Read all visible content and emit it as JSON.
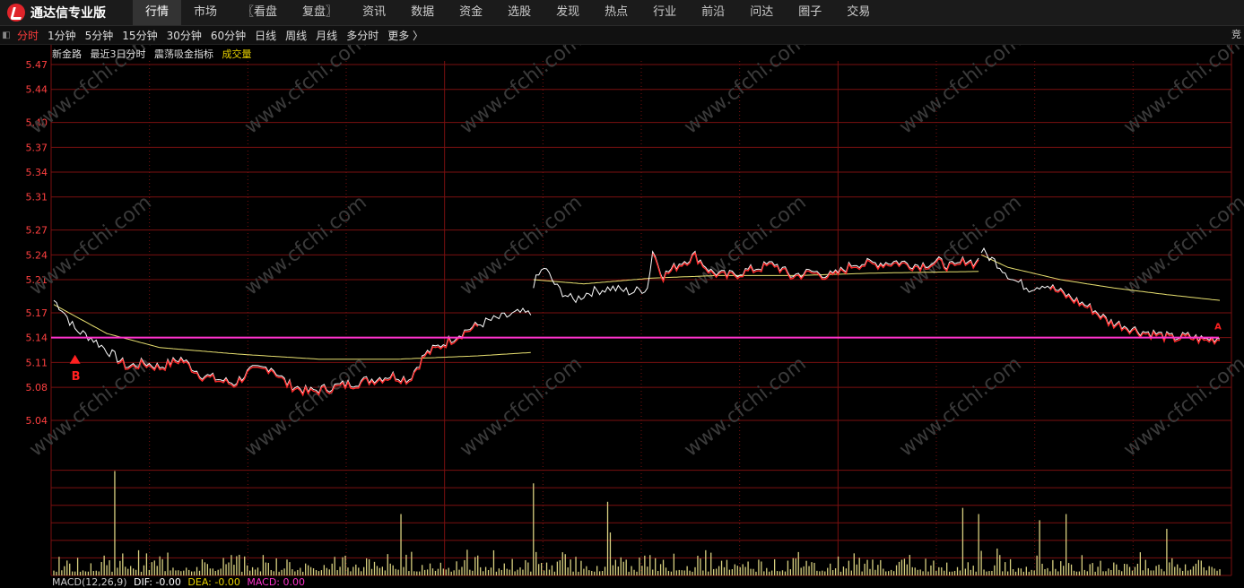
{
  "app": {
    "title": "通达信专业版"
  },
  "menu": [
    "行情",
    "市场",
    "〖看盘",
    "复盘〗",
    "资讯",
    "数据",
    "资金",
    "选股",
    "发现",
    "热点",
    "行业",
    "前沿",
    "问达",
    "圈子",
    "交易"
  ],
  "menu_active": "行情",
  "periods": [
    "分时",
    "1分钟",
    "5分钟",
    "15分钟",
    "30分钟",
    "60分钟",
    "日线",
    "周线",
    "月线",
    "多分时",
    "更多 〉"
  ],
  "period_active": "分时",
  "right_edge_text": "竞",
  "stock": {
    "name": "新金路",
    "mode": "最近3日分时",
    "indicator": "震荡吸金指标",
    "volume_label": "成交量"
  },
  "macd": {
    "title": "MACD(12,26,9)",
    "dif": "DIF: -0.00",
    "dea": "DEA: -0.00",
    "macd": "MACD: 0.00"
  },
  "watermark": "www.cfchi.com",
  "signals": {
    "buy": "B",
    "sell": "A"
  },
  "colors": {
    "grid": "#7a1010",
    "price_axis": "#ff4040",
    "price_up": "#ffffff",
    "price_down": "#ff2a2a",
    "avg_line": "#e8e070",
    "ref_line": "#ff33cc",
    "volume": "#d8d080",
    "active": "#ff3b3b"
  },
  "chart_data": {
    "type": "line",
    "price_ticks": [
      "5.47",
      "5.44",
      "5.40",
      "5.37",
      "5.34",
      "5.31",
      "5.27",
      "5.24",
      "5.21",
      "5.17",
      "5.14",
      "5.11",
      "5.08",
      "5.04"
    ],
    "ylim": [
      5.04,
      5.47
    ],
    "reference_price": 5.14,
    "days": 3,
    "price_keypoints": [
      [
        0,
        5.185
      ],
      [
        3,
        5.175
      ],
      [
        8,
        5.15
      ],
      [
        14,
        5.14
      ],
      [
        20,
        5.125
      ],
      [
        28,
        5.105
      ],
      [
        34,
        5.11
      ],
      [
        40,
        5.105
      ],
      [
        48,
        5.115
      ],
      [
        56,
        5.095
      ],
      [
        62,
        5.09
      ],
      [
        68,
        5.085
      ],
      [
        74,
        5.1
      ],
      [
        82,
        5.105
      ],
      [
        88,
        5.085
      ],
      [
        96,
        5.075
      ],
      [
        104,
        5.08
      ],
      [
        112,
        5.085
      ],
      [
        120,
        5.09
      ],
      [
        128,
        5.095
      ],
      [
        134,
        5.09
      ],
      [
        140,
        5.12
      ],
      [
        148,
        5.135
      ],
      [
        156,
        5.15
      ],
      [
        164,
        5.16
      ],
      [
        170,
        5.165
      ],
      [
        176,
        5.17
      ],
      [
        180,
        5.168
      ],
      [
        181,
        5.205
      ],
      [
        185,
        5.225
      ],
      [
        190,
        5.2
      ],
      [
        196,
        5.185
      ],
      [
        202,
        5.195
      ],
      [
        210,
        5.2
      ],
      [
        218,
        5.195
      ],
      [
        224,
        5.2
      ],
      [
        226,
        5.245
      ],
      [
        230,
        5.215
      ],
      [
        236,
        5.23
      ],
      [
        242,
        5.24
      ],
      [
        248,
        5.22
      ],
      [
        254,
        5.215
      ],
      [
        260,
        5.22
      ],
      [
        266,
        5.225
      ],
      [
        272,
        5.23
      ],
      [
        278,
        5.215
      ],
      [
        286,
        5.22
      ],
      [
        294,
        5.215
      ],
      [
        302,
        5.23
      ],
      [
        310,
        5.23
      ],
      [
        318,
        5.232
      ],
      [
        326,
        5.228
      ],
      [
        334,
        5.232
      ],
      [
        340,
        5.225
      ],
      [
        344,
        5.235
      ],
      [
        348,
        5.23
      ],
      [
        350,
        5.245
      ],
      [
        356,
        5.23
      ],
      [
        362,
        5.21
      ],
      [
        368,
        5.2
      ],
      [
        374,
        5.205
      ],
      [
        380,
        5.195
      ],
      [
        386,
        5.185
      ],
      [
        392,
        5.175
      ],
      [
        398,
        5.16
      ],
      [
        404,
        5.155
      ],
      [
        410,
        5.148
      ],
      [
        416,
        5.145
      ],
      [
        422,
        5.14
      ],
      [
        428,
        5.142
      ],
      [
        434,
        5.138
      ],
      [
        440,
        5.14
      ]
    ],
    "avg_keypoints": [
      [
        0,
        5.18
      ],
      [
        20,
        5.145
      ],
      [
        40,
        5.128
      ],
      [
        70,
        5.12
      ],
      [
        100,
        5.114
      ],
      [
        130,
        5.114
      ],
      [
        160,
        5.118
      ],
      [
        180,
        5.122
      ],
      [
        181,
        5.21
      ],
      [
        200,
        5.205
      ],
      [
        226,
        5.212
      ],
      [
        250,
        5.215
      ],
      [
        280,
        5.215
      ],
      [
        310,
        5.218
      ],
      [
        349,
        5.22
      ],
      [
        350,
        5.24
      ],
      [
        360,
        5.225
      ],
      [
        380,
        5.21
      ],
      [
        400,
        5.2
      ],
      [
        420,
        5.192
      ],
      [
        440,
        5.185
      ]
    ],
    "buy_signal_price": 5.115,
    "volume_spikes": [
      [
        23,
        0.85
      ],
      [
        131,
        0.5
      ],
      [
        181,
        0.75
      ],
      [
        209,
        0.6
      ],
      [
        210,
        0.35
      ],
      [
        343,
        0.55
      ],
      [
        349,
        0.5
      ],
      [
        372,
        0.45
      ],
      [
        382,
        0.5
      ],
      [
        420,
        0.38
      ]
    ]
  }
}
